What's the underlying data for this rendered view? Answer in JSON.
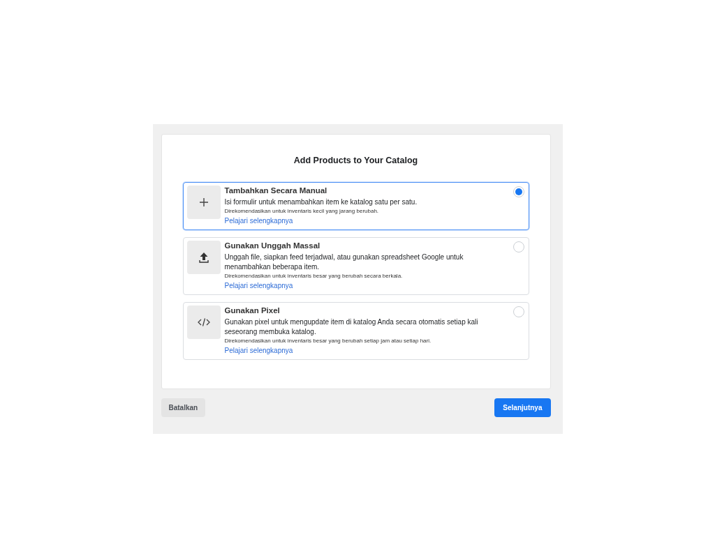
{
  "dialog": {
    "title": "Add Products to Your Catalog",
    "options": [
      {
        "kind": "plus",
        "title": "Tambahkan Secara Manual",
        "description": "Isi formulir untuk menambahkan item ke katalog satu per satu.",
        "note": "Direkomendasikan untuk inventaris kecil yang jarang berubah.",
        "link": "Pelajari selengkapnya",
        "selected": true
      },
      {
        "kind": "upload",
        "title": "Gunakan Unggah Massal",
        "description": "Unggah file, siapkan feed terjadwal, atau gunakan spreadsheet Google untuk menambahkan beberapa item.",
        "note": "Direkomendasikan untuk inventaris besar yang berubah secara berkala.",
        "link": "Pelajari selengkapnya",
        "selected": false
      },
      {
        "kind": "code",
        "title": "Gunakan Pixel",
        "description": "Gunakan pixel untuk mengupdate item di katalog Anda secara otomatis setiap kali seseorang membuka katalog.",
        "note": "Direkomendasikan untuk inventaris besar yang berubah setiap jam atau setiap hari.",
        "link": "Pelajari selengkapnya",
        "selected": false
      }
    ],
    "cancel_button": "Batalkan",
    "next_button": "Selanjutnya"
  }
}
